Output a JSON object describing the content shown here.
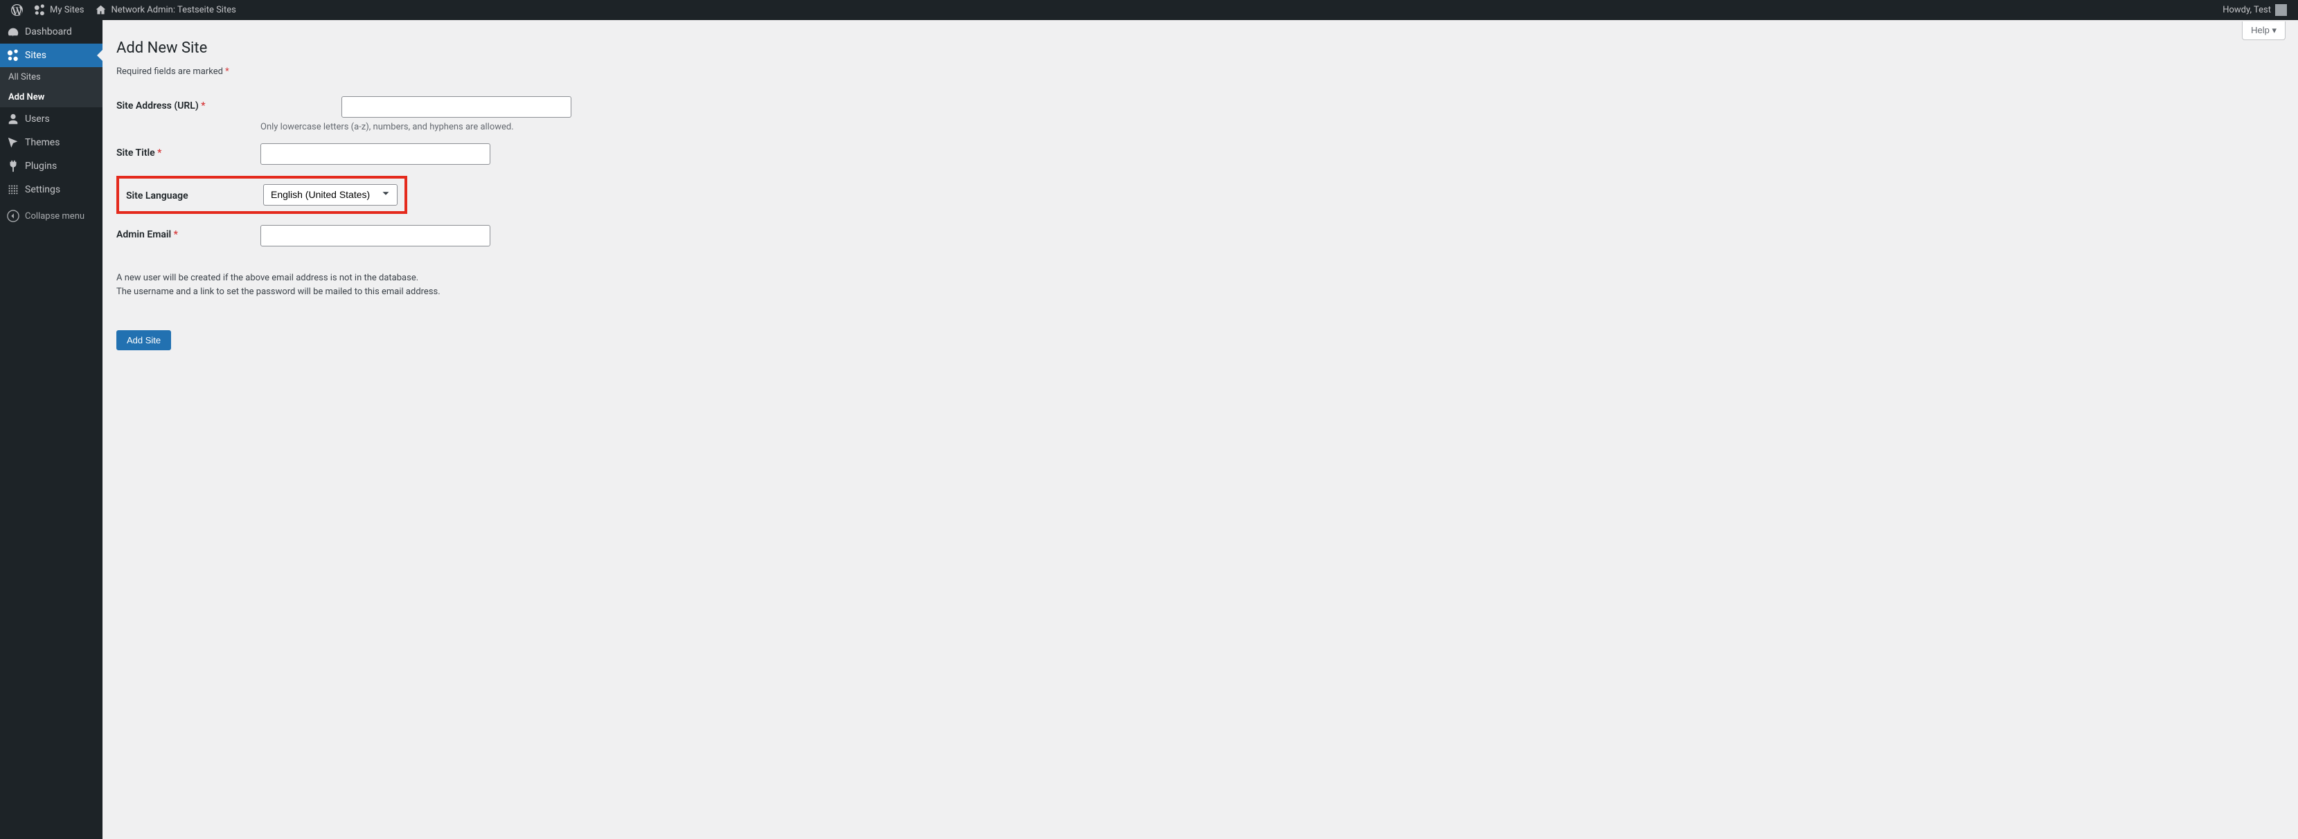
{
  "adminbar": {
    "mysites": "My Sites",
    "networkadmin": "Network Admin: Testseite Sites",
    "howdy": "Howdy, Test"
  },
  "sidebar": {
    "dashboard": "Dashboard",
    "sites": "Sites",
    "allsites": "All Sites",
    "addnew": "Add New",
    "users": "Users",
    "themes": "Themes",
    "plugins": "Plugins",
    "settings": "Settings",
    "collapse": "Collapse menu"
  },
  "help": "Help ▾",
  "page": {
    "title": "Add New Site",
    "required_note": "Required fields are marked ",
    "required_mark": "*"
  },
  "form": {
    "site_address_label": "Site Address (URL) ",
    "site_address_prefix": "",
    "site_address_desc": "Only lowercase letters (a-z), numbers, and hyphens are allowed.",
    "site_title_label": "Site Title ",
    "site_language_label": "Site Language",
    "site_language_value": "English (United States)",
    "admin_email_label": "Admin Email ",
    "info1": "A new user will be created if the above email address is not in the database.",
    "info2": "The username and a link to set the password will be mailed to this email address.",
    "submit": "Add Site"
  }
}
